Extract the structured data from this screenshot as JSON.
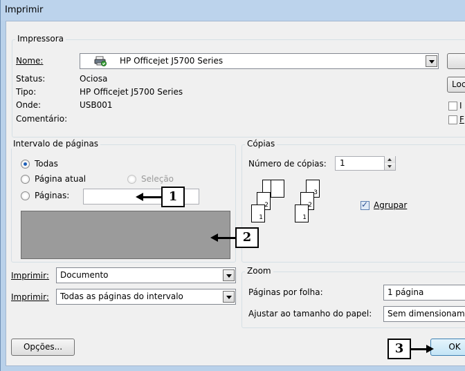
{
  "window": {
    "title": "Imprimir"
  },
  "printer": {
    "group_label": "Impressora",
    "name_label": "Nome:",
    "name_value": "HP Officejet J5700 Series",
    "status_label": "Status:",
    "status_value": "Ociosa",
    "type_label": "Tipo:",
    "type_value": "HP Officejet J5700 Series",
    "where_label": "Onde:",
    "where_value": "USB001",
    "comment_label": "Comentário:",
    "locate_label": "Loc",
    "check1_label": "I",
    "check2_label": "F"
  },
  "page_range": {
    "group_label": "Intervalo de páginas",
    "all_label": "Todas",
    "current_label": "Página atual",
    "selection_label": "Seleção",
    "pages_label": "Páginas:",
    "pages_value": ""
  },
  "copies": {
    "group_label": "Cópias",
    "count_label": "Número de cópias:",
    "count_value": "1",
    "collate_label": "Agrupar",
    "collate_checked": true,
    "stack_pages": [
      "3",
      "2",
      "1"
    ]
  },
  "print_what": {
    "label": "Imprimir:",
    "value": "Documento"
  },
  "print_range": {
    "label": "Imprimir:",
    "value": "Todas as páginas do intervalo"
  },
  "zoom": {
    "group_label": "Zoom",
    "pages_per_sheet_label": "Páginas por folha:",
    "pages_per_sheet_value": "1 página",
    "scale_label": "Ajustar ao tamanho do papel:",
    "scale_value": "Sem dimensionamer"
  },
  "buttons": {
    "options_label": "Opções...",
    "ok_label": "OK"
  },
  "callouts": [
    "1",
    "2",
    "3"
  ],
  "colors": {
    "titlebar": "#bcd3ec",
    "dialog": "#f0f0f0",
    "accent": "#1d5fb8",
    "gray_area": "#9b9b9b"
  }
}
